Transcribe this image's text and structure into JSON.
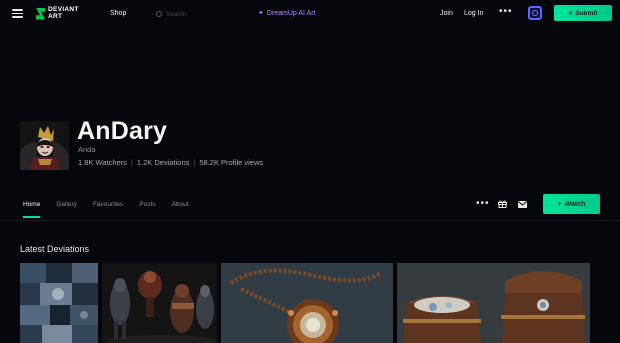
{
  "nav": {
    "logo_line1": "DEVIANT",
    "logo_line2": "ART",
    "shop": "Shop",
    "search_placeholder": "Search",
    "dreamup": "DreamUp AI Art",
    "join": "Join",
    "login": "Log In",
    "more": "•••",
    "submit": "Submit"
  },
  "profile": {
    "username": "AnDary",
    "realname": "Anda",
    "stats": [
      "1.8K Watchers",
      "1.2K Deviations",
      "58.2K Profile views"
    ],
    "stat_separator": "|"
  },
  "tabs": [
    {
      "label": "Home",
      "active": true
    },
    {
      "label": "Gallery",
      "active": false
    },
    {
      "label": "Favourites",
      "active": false
    },
    {
      "label": "Posts",
      "active": false
    },
    {
      "label": "About",
      "active": false
    }
  ],
  "actions": {
    "more": "•••",
    "watch": "Watch"
  },
  "section": {
    "title": "Latest Deviations"
  },
  "colors": {
    "accent": "#00e59b",
    "dreamup": "#b387ff",
    "background": "#06070d"
  }
}
